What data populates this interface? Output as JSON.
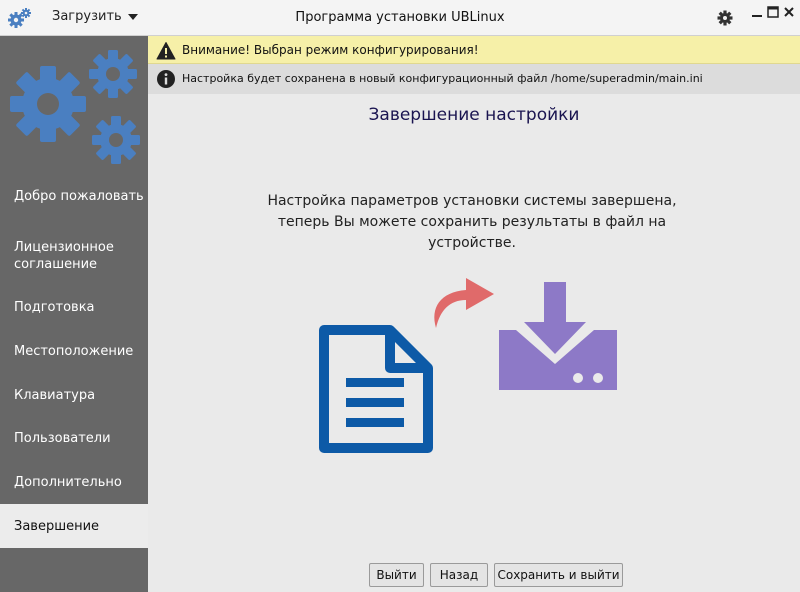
{
  "window": {
    "title": "Программа установки UBLinux",
    "load_menu_label": "Загрузить"
  },
  "colors": {
    "sidebar_bg": "#676767",
    "gear_blue": "#4a7fc1",
    "warning_bg": "#f6f0a8",
    "info_bg": "#dcdcdc",
    "document_blue": "#0d5aa7",
    "arrow_red": "#e06a6a",
    "download_purple": "#8d79c7",
    "title_color": "#1a1450"
  },
  "sidebar": {
    "items": [
      {
        "label": "Добро пожаловать"
      },
      {
        "label": "Лицензионное соглашение"
      },
      {
        "label": "Подготовка"
      },
      {
        "label": "Местоположение"
      },
      {
        "label": "Клавиатура"
      },
      {
        "label": "Пользователи"
      },
      {
        "label": "Дополнительно"
      },
      {
        "label": "Завершение",
        "active": true
      }
    ]
  },
  "notices": {
    "warning": "Внимание! Выбран режим конфигурирования!",
    "info": "Настройка будет сохранена в новый конфигурационный файл /home/superadmin/main.ini"
  },
  "main": {
    "title": "Завершение настройки",
    "message": "Настройка параметров установки системы завершена, теперь Вы можете сохранить результаты в файл на устройстве."
  },
  "icons": {
    "app": "gears-icon",
    "settings": "gear-icon",
    "document": "document-icon",
    "arrow": "curved-arrow-icon",
    "download": "download-to-drive-icon"
  },
  "buttons": {
    "exit": "Выйти",
    "back": "Назад",
    "save_exit": "Сохранить и выйти"
  }
}
